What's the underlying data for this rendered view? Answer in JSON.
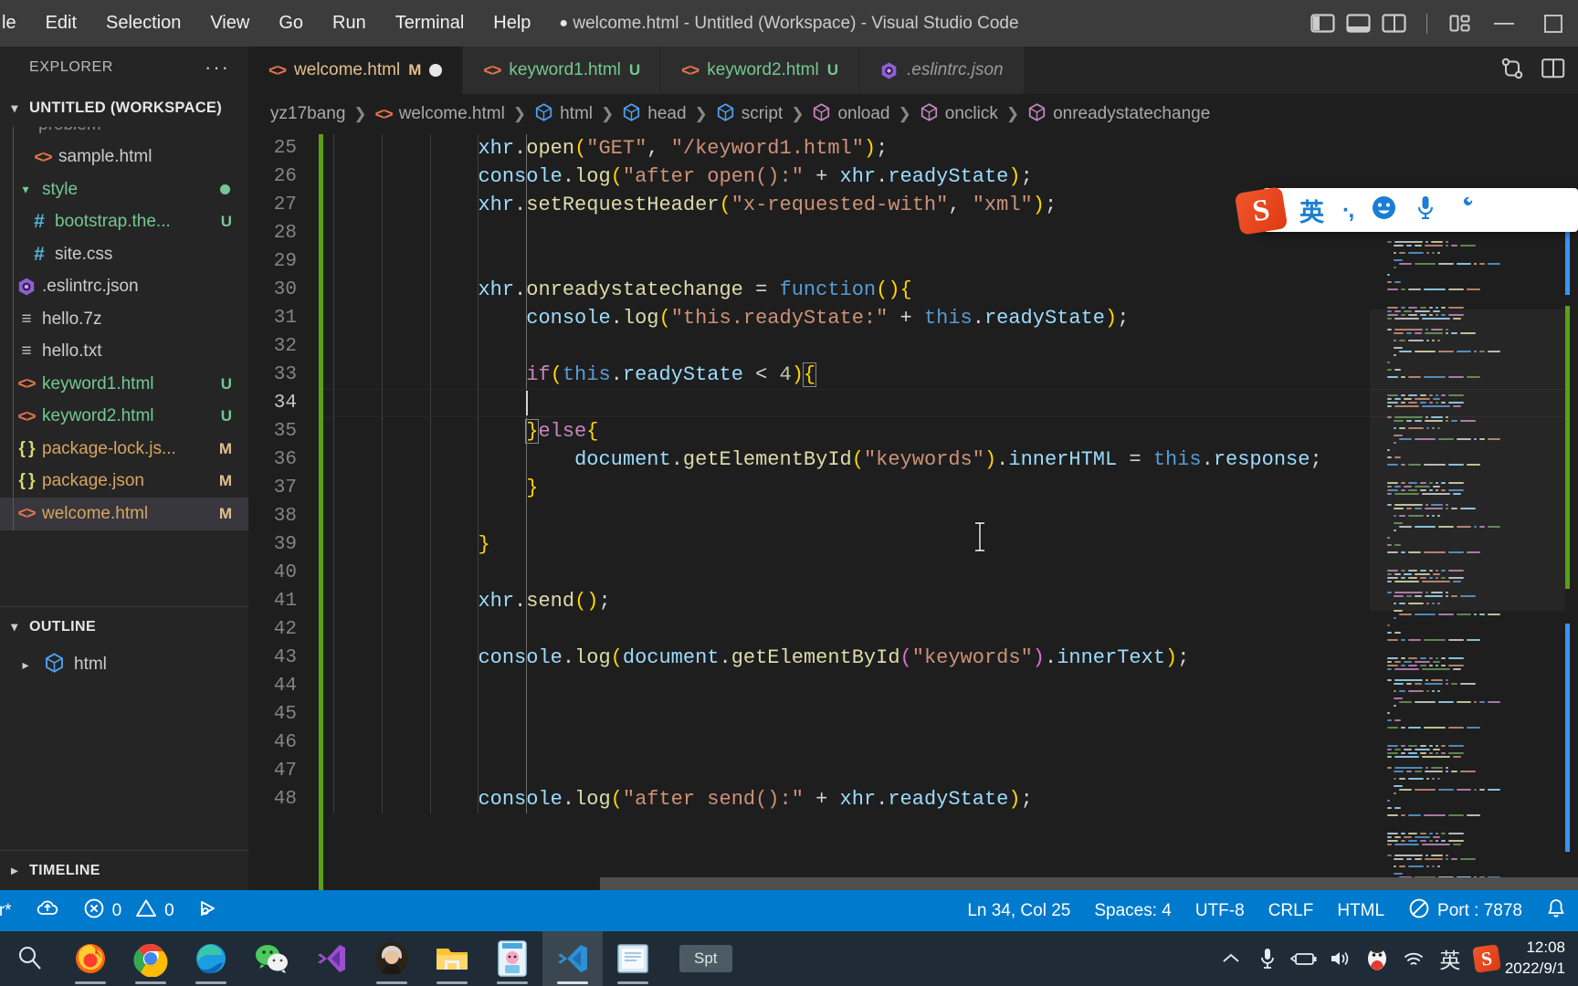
{
  "titlebar": {
    "menus": [
      "le",
      "Edit",
      "Selection",
      "View",
      "Go",
      "Run",
      "Terminal",
      "Help"
    ],
    "title_prefix": "●",
    "title": "welcome.html - Untitled (Workspace) - Visual Studio Code",
    "layout_icons": [
      "toggle-primary-sidebar-icon",
      "toggle-panel-icon",
      "toggle-secondary-sidebar-icon",
      "customize-layout-icon"
    ],
    "window_controls": [
      "minimize",
      "maximize"
    ]
  },
  "sidebar": {
    "header": "EXPLORER",
    "more_actions": "···",
    "workspace": "UNTITLED (WORKSPACE)",
    "files": [
      {
        "name": "problem",
        "icon": "folder-icon",
        "badge": "",
        "kind": "folder-cut",
        "selected": false
      },
      {
        "name": "sample.html",
        "icon": "html-icon",
        "badge": "",
        "kind": "html",
        "selected": false
      },
      {
        "name": "style",
        "icon": "folder-open-icon",
        "badge": "●",
        "kind": "folder",
        "selected": false
      },
      {
        "name": "bootstrap.the...",
        "icon": "css-icon",
        "badge": "U",
        "kind": "css-untracked",
        "selected": false
      },
      {
        "name": "site.css",
        "icon": "css-icon",
        "badge": "",
        "kind": "css",
        "selected": false
      },
      {
        "name": ".eslintrc.json",
        "icon": "eslint-icon",
        "badge": "",
        "kind": "eslint",
        "selected": false
      },
      {
        "name": "hello.7z",
        "icon": "text-icon",
        "badge": "",
        "kind": "text",
        "selected": false
      },
      {
        "name": "hello.txt",
        "icon": "text-icon",
        "badge": "",
        "kind": "text",
        "selected": false
      },
      {
        "name": "keyword1.html",
        "icon": "html-icon",
        "badge": "U",
        "kind": "html-untracked",
        "selected": false
      },
      {
        "name": "keyword2.html",
        "icon": "html-icon",
        "badge": "U",
        "kind": "html-untracked",
        "selected": false
      },
      {
        "name": "package-lock.js...",
        "icon": "json-icon",
        "badge": "M",
        "kind": "json-modified",
        "selected": false
      },
      {
        "name": "package.json",
        "icon": "json-icon",
        "badge": "M",
        "kind": "json-modified",
        "selected": false
      },
      {
        "name": "welcome.html",
        "icon": "html-icon",
        "badge": "M",
        "kind": "html-modified",
        "selected": true
      }
    ],
    "outline": {
      "header": "OUTLINE",
      "items": [
        {
          "label": "html",
          "icon": "html-tag-icon"
        }
      ]
    },
    "timeline": {
      "header": "TIMELINE"
    }
  },
  "tabs": [
    {
      "label": "welcome.html",
      "badge": "M",
      "state": "modified",
      "active": true,
      "dirty": true,
      "icon": "html-icon"
    },
    {
      "label": "keyword1.html",
      "badge": "U",
      "state": "untracked",
      "active": false,
      "dirty": false,
      "icon": "html-icon"
    },
    {
      "label": "keyword2.html",
      "badge": "U",
      "state": "untracked",
      "active": false,
      "dirty": false,
      "icon": "html-icon"
    },
    {
      "label": ".eslintrc.json",
      "badge": "",
      "state": "italic",
      "active": false,
      "dirty": false,
      "icon": "eslint-icon"
    }
  ],
  "breadcrumb": [
    {
      "label": "yz17bang",
      "icon": ""
    },
    {
      "label": "welcome.html",
      "icon": "html-icon"
    },
    {
      "label": "html",
      "icon": "symbol-blue-icon"
    },
    {
      "label": "head",
      "icon": "symbol-blue-icon"
    },
    {
      "label": "script",
      "icon": "symbol-blue-icon"
    },
    {
      "label": "onload",
      "icon": "symbol-purple-icon"
    },
    {
      "label": "onclick",
      "icon": "symbol-purple-icon"
    },
    {
      "label": "onreadystatechange",
      "icon": "symbol-purple-icon"
    }
  ],
  "code": {
    "first_line": 25,
    "lines": [
      {
        "n": 25,
        "text": "            xhr.open(\"GET\", \"/keyword1.html\");"
      },
      {
        "n": 26,
        "text": "            console.log(\"after open():\" + xhr.readyState);"
      },
      {
        "n": 27,
        "text": "            xhr.setRequestHeader(\"x-requested-with\", \"xml\");"
      },
      {
        "n": 28,
        "text": ""
      },
      {
        "n": 29,
        "text": ""
      },
      {
        "n": 30,
        "text": "            xhr.onreadystatechange = function(){"
      },
      {
        "n": 31,
        "text": "                console.log(\"this.readyState:\" + this.readyState);"
      },
      {
        "n": 32,
        "text": ""
      },
      {
        "n": 33,
        "text": "                if(this.readyState < 4){"
      },
      {
        "n": 34,
        "text": ""
      },
      {
        "n": 35,
        "text": "                }else{"
      },
      {
        "n": 36,
        "text": "                    document.getElementById(\"keywords\").innerHTML = this.response;"
      },
      {
        "n": 37,
        "text": "                }"
      },
      {
        "n": 38,
        "text": ""
      },
      {
        "n": 39,
        "text": "            }"
      },
      {
        "n": 40,
        "text": ""
      },
      {
        "n": 41,
        "text": "            xhr.send();"
      },
      {
        "n": 42,
        "text": ""
      },
      {
        "n": 43,
        "text": "            console.log(document.getElementById(\"keywords\").innerText);"
      },
      {
        "n": 44,
        "text": ""
      },
      {
        "n": 45,
        "text": ""
      },
      {
        "n": 46,
        "text": ""
      },
      {
        "n": 47,
        "text": ""
      },
      {
        "n": 48,
        "text": "            console.log(\"after send():\" + xhr.readyState);"
      }
    ],
    "active_line": 34
  },
  "statusbar": {
    "left": [
      {
        "label": "ter*",
        "icon": "source-control-branch-icon"
      },
      {
        "label": "",
        "icon": "sync-cloud-icon"
      },
      {
        "label": "0",
        "icon": "error-icon"
      },
      {
        "label": "0",
        "icon": "warning-icon"
      },
      {
        "label": "",
        "icon": "ports-forward-icon"
      }
    ],
    "right": [
      {
        "label": "Ln 34, Col 25",
        "icon": ""
      },
      {
        "label": "Spaces: 4",
        "icon": ""
      },
      {
        "label": "UTF-8",
        "icon": ""
      },
      {
        "label": "CRLF",
        "icon": ""
      },
      {
        "label": "HTML",
        "icon": ""
      },
      {
        "label": "Port : 7878",
        "icon": "no-entry-icon"
      },
      {
        "label": "",
        "icon": "bell-icon"
      }
    ]
  },
  "taskbar": {
    "items": [
      {
        "name": "search-icon",
        "running": false,
        "active": false
      },
      {
        "name": "firefox-icon",
        "running": true,
        "active": false
      },
      {
        "name": "chrome-icon",
        "running": true,
        "active": false
      },
      {
        "name": "edge-icon",
        "running": true,
        "active": false
      },
      {
        "name": "wechat-icon",
        "running": false,
        "active": false
      },
      {
        "name": "visual-studio-icon",
        "running": false,
        "active": false
      },
      {
        "name": "avatar-icon",
        "running": true,
        "active": false
      },
      {
        "name": "file-explorer-icon",
        "running": true,
        "active": false
      },
      {
        "name": "app-icon",
        "running": true,
        "active": false
      },
      {
        "name": "vscode-icon",
        "running": true,
        "active": true
      },
      {
        "name": "notepad-icon",
        "running": true,
        "active": false
      }
    ],
    "task_label": "Spt",
    "tray": [
      "chevron-up-icon",
      "microphone-icon",
      "battery-icon",
      "volume-icon",
      "qq-icon",
      "wifi-icon",
      "ime-lang-icon",
      "sogou-icon"
    ],
    "ime_lang": "英",
    "clock_time": "12:08",
    "clock_date": "2022/9/1"
  },
  "ime_bar": {
    "logo": "S",
    "lang": "英",
    "items": [
      "punctuation-icon",
      "emoji-icon",
      "microphone-icon",
      "toolbox-icon"
    ]
  }
}
